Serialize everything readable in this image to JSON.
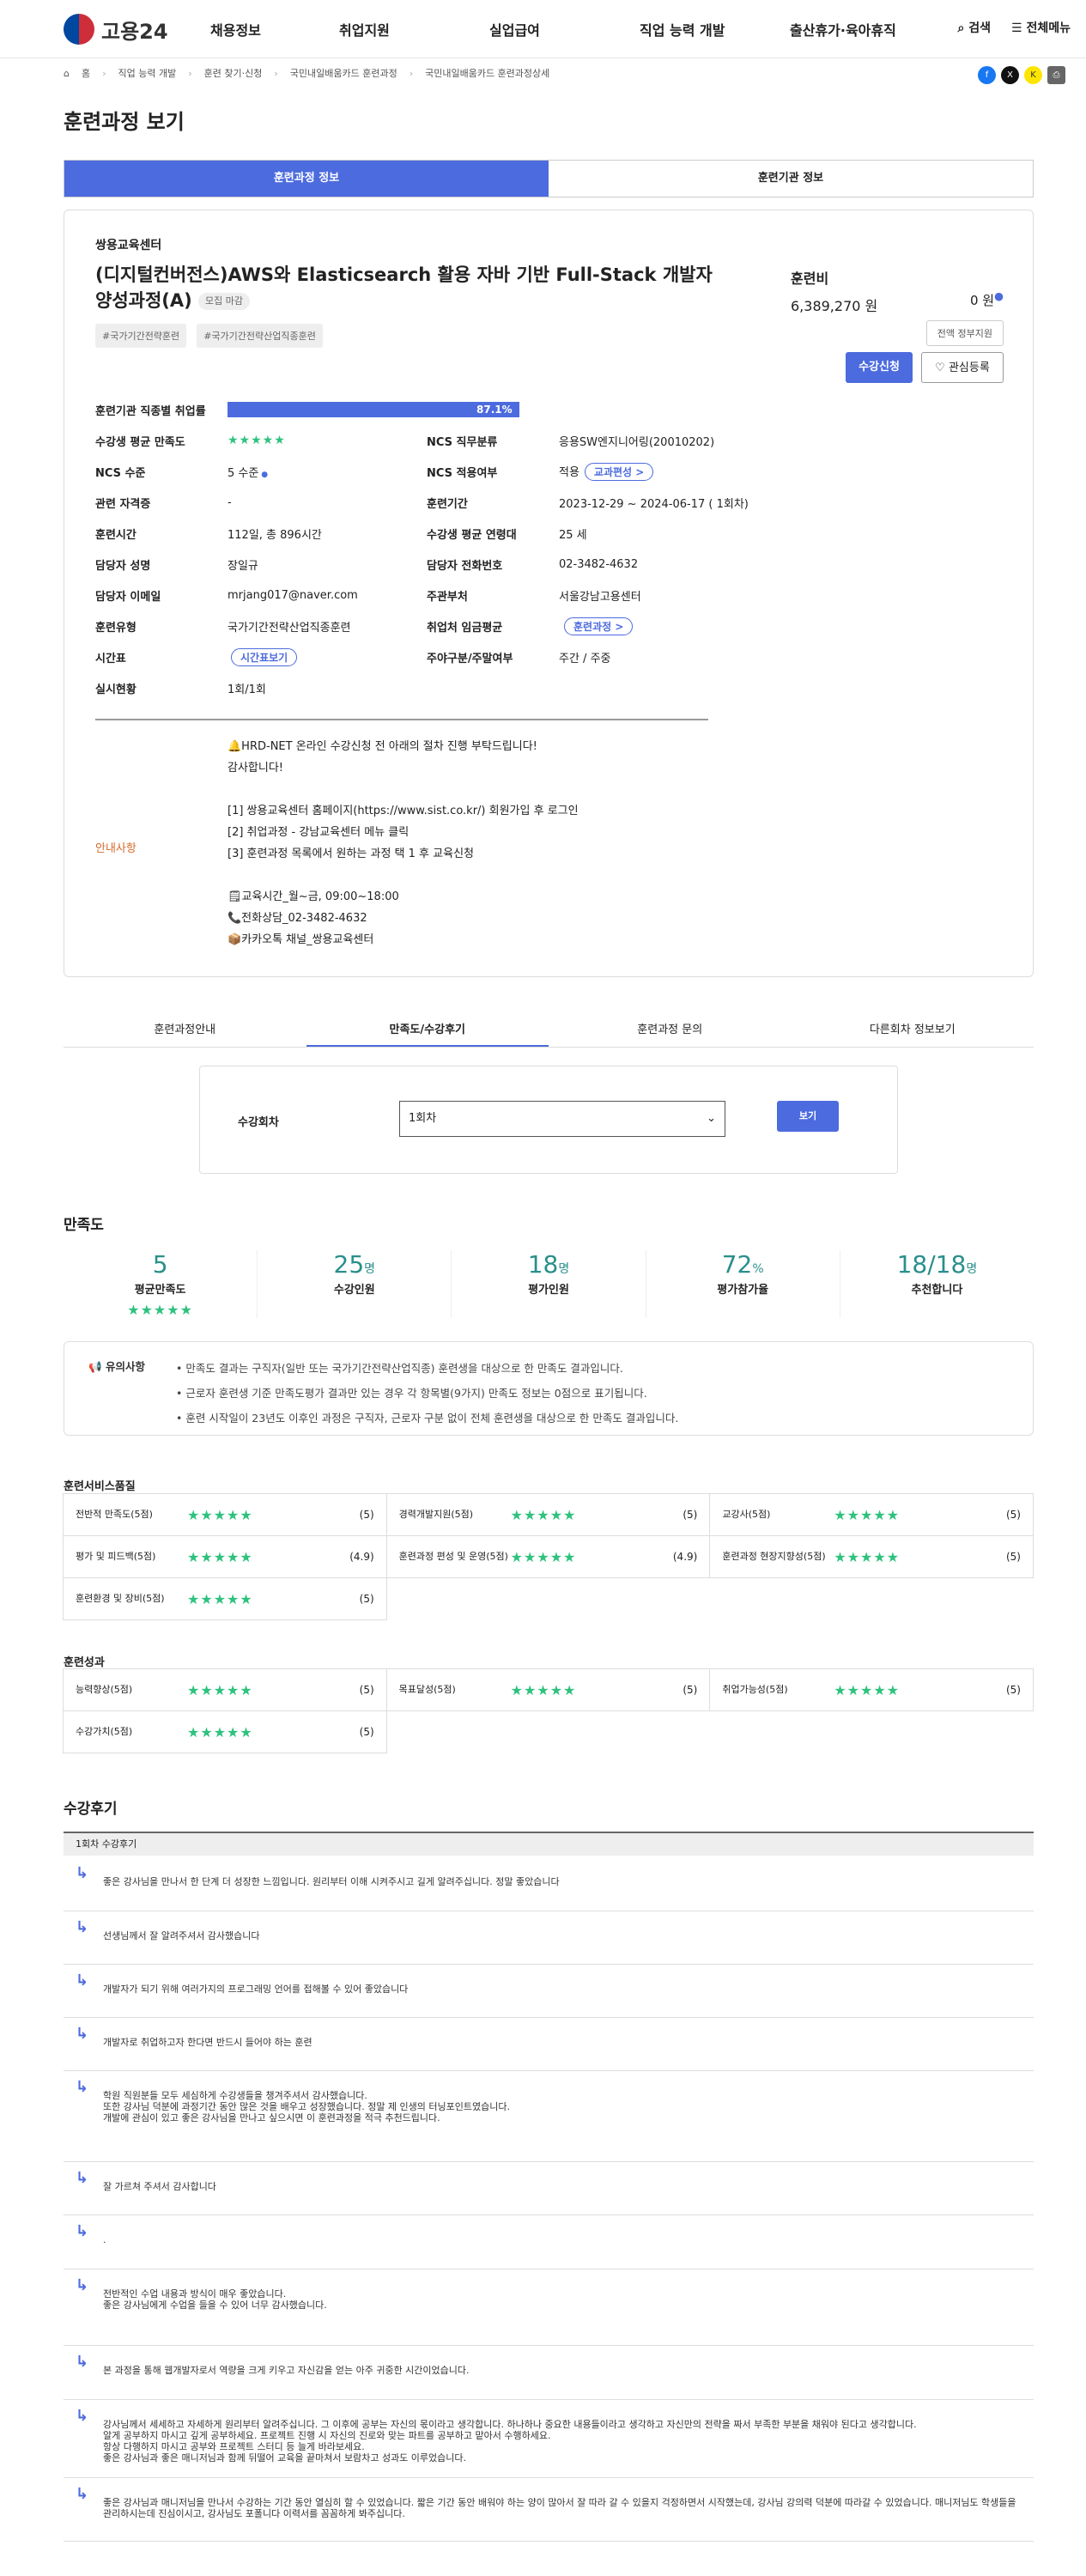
{
  "header": {
    "logo": "고용24",
    "nav": [
      "채용정보",
      "취업지원",
      "실업급여",
      "직업 능력 개발",
      "출산휴가·육아휴직"
    ],
    "search": "검색",
    "menu": "전체메뉴"
  },
  "breadcrumb": [
    "홈",
    "직업 능력 개발",
    "훈련 찾기·신청",
    "국민내일배움카드 훈련과정",
    "국민내일배움카드 훈련과정상세"
  ],
  "page_title": "훈련과정 보기",
  "tabs": [
    "훈련과정 정보",
    "훈련기관 정보"
  ],
  "course": {
    "institution": "쌍용교육센터",
    "title": "(디지털컨버전스)AWS와 Elasticsearch 활용 자바 기반 Full-Stack 개발자 양성과정(A)",
    "recruit": "모집 마감",
    "tags": [
      "#국가기간전략훈련",
      "#국가기간전략산업직종훈련"
    ],
    "fee_label": "훈련비",
    "fee": "6,389,270 원",
    "self_pay": "0 원",
    "support_btn": "전액 정부지원",
    "apply_btn": "수강신청",
    "interest_btn": "관심등록",
    "employment_label": "훈련기관 직종별 취업률",
    "employment_rate": "87.1%",
    "employment_value": 87.1,
    "rows": [
      {
        "k1": "수강생 평균 만족도",
        "v1": "★★★★★",
        "k2": "NCS 직무분류",
        "v2": "응용SW엔지니어링(20010202)"
      },
      {
        "k1": "NCS 수준",
        "v1": "5 수준",
        "k2": "NCS 적용여부",
        "v2": "적용",
        "pill2": "교과편성 >"
      },
      {
        "k1": "관련 자격증",
        "v1": "-",
        "k2": "훈련기간",
        "v2": "2023-12-29 ~ 2024-06-17 ( 1회차)"
      },
      {
        "k1": "훈련시간",
        "v1": "112일, 총 896시간",
        "k2": "수강생 평균 연령대",
        "v2": "25 세"
      },
      {
        "k1": "담당자 성명",
        "v1": "장일규",
        "k2": "담당자 전화번호",
        "v2": "02-3482-4632"
      },
      {
        "k1": "담당자 이메일",
        "v1": "mrjang017@naver.com",
        "k2": "주관부처",
        "v2": "서울강남고용센터"
      },
      {
        "k1": "훈련유형",
        "v1": "국가기간전략산업직종훈련",
        "k2": "취업처 임금평균",
        "v2": "",
        "pill2": "훈련과정 >"
      },
      {
        "k1": "시간표",
        "v1": "",
        "pill1": "시간표보기",
        "k2": "주야구분/주말여부",
        "v2": "주간 / 주중"
      },
      {
        "k1": "실시현황",
        "v1": "1회/1회",
        "k2": "",
        "v2": ""
      }
    ],
    "guide_label": "안내사항",
    "guide_lines": [
      "🔔HRD-NET 온라인 수강신청 전 아래의 절차 진행 부탁드립니다!",
      "감사합니다!",
      "",
      "[1] 쌍용교육센터 홈페이지(https://www.sist.co.kr/) 회원가입 후 로그인",
      "[2] 취업과정 - 강남교육센터 메뉴 클릭",
      "[3] 훈련과정 목록에서 원하는 과정 택 1 후 교육신청",
      "",
      "🗒교육시간_월~금, 09:00~18:00",
      "📞전화상담_02-3482-4632",
      "📦카카오톡 채널_쌍용교육센터"
    ]
  },
  "sub_tabs": [
    "훈련과정안내",
    "만족도/수강후기",
    "훈련과정 문의",
    "다른회차 정보보기"
  ],
  "round_select": {
    "label": "수강회차",
    "value": "1회차",
    "button": "보기"
  },
  "satisfaction": {
    "title": "만족도",
    "kpis": [
      {
        "n": "5",
        "u": "",
        "t": "평균만족도"
      },
      {
        "n": "25",
        "u": "명",
        "t": "수강인원"
      },
      {
        "n": "18",
        "u": "명",
        "t": "평가인원"
      },
      {
        "n": "72",
        "u": "%",
        "t": "평가참가율"
      },
      {
        "n": "18/18",
        "u": "명",
        "t": "추천합니다"
      }
    ],
    "notice_title": "유의사항",
    "notices": [
      "만족도 결과는 구직자(일반 또는 국가기간전략산업직종) 훈련생을 대상으로 한 만족도 결과입니다.",
      "근로자 훈련생 기준 만족도평가 결과만 있는 경우 각 항목별(9가지) 만족도 정보는 0점으로 표기됩니다.",
      "훈련 시작일이 23년도 이후인 과정은 구직자, 근로자 구분 없이 전체 훈련생을 대상으로 한 만족도 결과입니다."
    ]
  },
  "service_quality": {
    "title": "훈련서비스품질",
    "items": [
      {
        "l": "전반적 만족도(5점)",
        "v": "(5)"
      },
      {
        "l": "경력개발지원(5점)",
        "v": "(5)"
      },
      {
        "l": "교강사(5점)",
        "v": "(5)"
      },
      {
        "l": "평가 및 피드백(5점)",
        "v": "(4.9)"
      },
      {
        "l": "훈련과정 편성 및 운영(5점)",
        "v": "(4.9)"
      },
      {
        "l": "훈련과정 현장지향성(5점)",
        "v": "(5)"
      },
      {
        "l": "훈련환경 및 장비(5점)",
        "v": "(5)"
      }
    ]
  },
  "outcome": {
    "title": "훈련성과",
    "items": [
      {
        "l": "능력향상(5점)",
        "v": "(5)"
      },
      {
        "l": "목표달성(5점)",
        "v": "(5)"
      },
      {
        "l": "취업가능성(5점)",
        "v": "(5)"
      },
      {
        "l": "수강가치(5점)",
        "v": "(5)"
      }
    ]
  },
  "reviews": {
    "title": "수강후기",
    "head": "1회차 수강후기",
    "items": [
      "좋은 강사님을 만나서 한 단계 더 성장한 느낌입니다. 원리부터 이해 시켜주시고 길게 알려주십니다. 정말 좋았습니다",
      "선생님께서 잘 알려주셔서 감사했습니다",
      "개발자가 되기 위해 여러가지의 프로그래밍 언어를 접해볼 수 있어 좋았습니다",
      "개발자로 취업하고자 한다면 반드시 들어야 하는 훈련",
      "학원 직원분들 모두 세심하게 수강생들을 챙겨주셔서 감사했습니다.\n또한 강사님 덕분에 과정기간 동안 많은 것을 배우고 성장했습니다. 정말 제 인생의 터닝포인트였습니다.\n개발에 관심이 있고 좋은 강사님을 만나고 싶으시면 이 훈련과정을 적극 추천드립니다.",
      "잘 가르쳐 주셔서 감사합니다",
      ".",
      "전반적인 수업 내용과 방식이 매우 좋았습니다.\n좋은 강사님에게 수업을 들을 수 있어 너무 감사했습니다.",
      "본 과정을 통해 웹개발자로서 역량을 크게 키우고 자신감을 얻는 아주 귀중한 시간이었습니다.",
      "강사님께서 세세하고 자세하게 원리부터 알려주십니다. 그 이후에 공부는 자신의 몫이라고 생각합니다. 하나하나 중요한 내용들이라고 생각하고 자신만의 전략을 짜서 부족한 부분을 채워야 된다고 생각합니다.\n알게 공부하지 마시고 깊게  공부하세요. 프로젝트 진행 시 자신의 진로와 맞는 파트를 공부하고 맡아서 수행하세요.\n항상 다행하지 마시고 공부와 프로젝트 스터디 등 늘게 바라보세요.\n좋은 강사님과 좋은 매니저님과 함께 뒤떨어 교육을 끝마쳐서 보람차고 성과도 이루었습니다.",
      "좋은 강사님과 매니저님을 만나서 수강하는 기간 동안 열심히 할 수 있었습니다. 짧은 기간 동안 배워야 하는 양이 많아서 잘 따라 갈 수 있을지 걱정하면서 시작했는데, 강사님 강의력 덕분에 따라갈 수 있었습니다. 매니저님도 학생들을 관리하시는데 진심이시고, 강사님도 포폴니다 이력서를 꼼꼼하게 봐주십니다."
    ]
  },
  "colors": {
    "accent": "#4c6bde",
    "star": "#2ec27e",
    "teal": "#2a8f8b",
    "guide": "#d46a2a"
  }
}
